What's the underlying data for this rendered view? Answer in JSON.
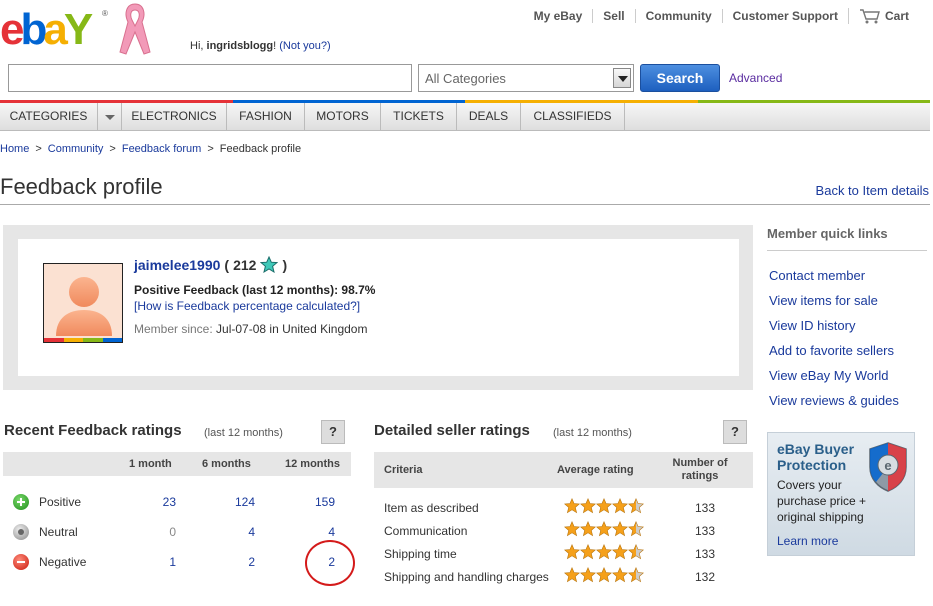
{
  "header": {
    "greeting_prefix": "Hi,",
    "username": "ingridsblogg",
    "not_you": "(Not you?)",
    "nav": [
      "My eBay",
      "Sell",
      "Community",
      "Customer Support"
    ],
    "cart": "Cart"
  },
  "search": {
    "placeholder": "",
    "category": "All Categories",
    "button": "Search",
    "advanced": "Advanced"
  },
  "categories": [
    "CATEGORIES",
    "ELECTRONICS",
    "FASHION",
    "MOTORS",
    "TICKETS",
    "DEALS",
    "CLASSIFIEDS"
  ],
  "breadcrumb": [
    "Home",
    "Community",
    "Feedback forum",
    "Feedback profile"
  ],
  "page": {
    "title": "Feedback profile",
    "back_link": "Back to Item details"
  },
  "member": {
    "name": "jaimelee1990",
    "score_open": "(",
    "score": "212",
    "score_close": ")",
    "positive_feedback": "Positive Feedback (last 12 months): 98.7%",
    "pct_link": "[How is Feedback percentage calculated?]",
    "since_label": "Member since:",
    "since_value": "Jul-07-08 in United Kingdom"
  },
  "quick_links": {
    "title": "Member quick links",
    "items": [
      "Contact member",
      "View items for sale",
      "View ID history",
      "Add to favorite sellers",
      "View eBay My World",
      "View reviews & guides"
    ]
  },
  "protection": {
    "title": "eBay Buyer Protection",
    "body": "Covers your purchase price + original shipping",
    "link": "Learn more"
  },
  "recent_ratings": {
    "title": "Recent Feedback ratings",
    "subtitle": "(last 12 months)",
    "help": "?",
    "columns": [
      "1 month",
      "6 months",
      "12 months"
    ],
    "rows": [
      {
        "label": "Positive",
        "values": [
          "23",
          "124",
          "159"
        ]
      },
      {
        "label": "Neutral",
        "values": [
          "0",
          "4",
          "4"
        ]
      },
      {
        "label": "Negative",
        "values": [
          "1",
          "2",
          "2"
        ]
      }
    ]
  },
  "seller_ratings": {
    "title": "Detailed seller ratings",
    "subtitle": "(last 12 months)",
    "help": "?",
    "col_criteria": "Criteria",
    "col_avg": "Average rating",
    "col_num": "Number of ratings",
    "rows": [
      {
        "criteria": "Item as described",
        "stars": 4.5,
        "count": "133"
      },
      {
        "criteria": "Communication",
        "stars": 4.5,
        "count": "133"
      },
      {
        "criteria": "Shipping time",
        "stars": 4.5,
        "count": "133"
      },
      {
        "criteria": "Shipping and handling charges",
        "stars": 4.5,
        "count": "132"
      }
    ]
  },
  "colors": {
    "link": "#1a3a9c",
    "star": "#f5a01a",
    "search_button": "#1d5fbf",
    "stripe": [
      "#e53238",
      "#f5af02",
      "#86b817",
      "#0064d2"
    ]
  }
}
